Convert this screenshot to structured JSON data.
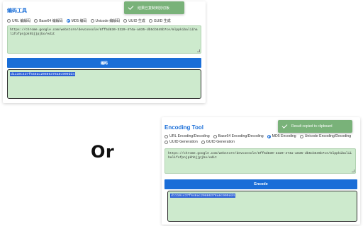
{
  "cn_panel": {
    "title": "编码工具",
    "options": [
      "URL 编解码",
      "Base64 编解码",
      "MD5 编码",
      "Unicode 编解码",
      "UUID 生成",
      "GUID 生成"
    ],
    "selected": "MD5 编码",
    "input_value": "https://chrome.google.com/webstore/devconsole/8ff5d830-3320-474a-a835-db5cb545b7ce/mlppkibaliihalifofpnjpkhbjjpjbo/edit",
    "button_label": "编码",
    "output_value": "d1110c437f648ac20886378a8c909dd4",
    "toast_text": "结果已复制到剪切板"
  },
  "en_panel": {
    "title": "Encoding Tool",
    "options": [
      "URL Encoding/Decoding",
      "Base64 Encoding/Decoding",
      "MD5 Encoding",
      "Unicode Encoding/Decoding",
      "UUID Generation",
      "GUID Generation"
    ],
    "selected": "MD5 Encoding",
    "input_value": "https://chrome.google.com/webstore/devconsole/8ff5d830-3320-474a-a835-db5cb545b7ce/mlppkibaliihalifofpnjpkhbjjpjbo/edit",
    "button_label": "Encode",
    "output_value": "d1110c437f648ac20886378a8c909dd4",
    "toast_text": "Result copied to clipboard"
  },
  "separator_text": "Or",
  "colors": {
    "accent": "#1a6ed8",
    "textarea_bg": "#cdeacd",
    "toast_bg": "#79b279",
    "selection_bg": "#2a5fd6"
  }
}
